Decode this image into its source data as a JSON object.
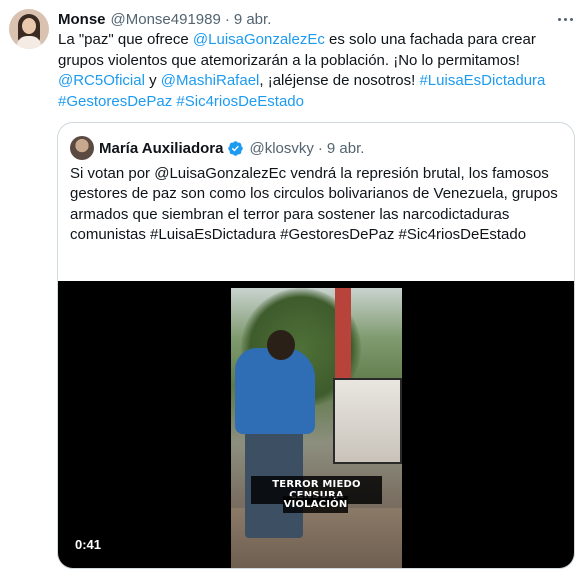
{
  "tweet": {
    "author_name": "Monse",
    "author_handle": "@Monse491989",
    "separator": "·",
    "time": "9 abr.",
    "text_parts": {
      "p1": "La \"paz\" que ofrece ",
      "m1": "@LuisaGonzalezEc",
      "p2": " es solo una fachada para crear grupos violentos que atemorizarán a la población. ¡No lo permitamos! ",
      "m2": "@RC5Oficial",
      "p3": " y ",
      "m3": "@MashiRafael",
      "p4": ", ¡aléjense de nosotros! ",
      "h1": "#LuisaEsDictadura",
      "sp1": " ",
      "h2": "#GestoresDePaz",
      "sp2": " ",
      "h3": "#Sic4riosDeEstado"
    },
    "more_icon": "more-horizontal-icon"
  },
  "quote": {
    "author_name": "María Auxiliadora",
    "verified_icon": "verified-badge-icon",
    "verified_color": "#1d9bf0",
    "author_handle": "@klosvky",
    "separator": "·",
    "time": "9 abr.",
    "text": "Si votan por @LuisaGonzalezEc vendrá la represión brutal, los famosos gestores de paz son como los circulos bolivarianos de Venezuela, grupos armados que siembran el terror para sostener las narcodictaduras comunistas #LuisaEsDictadura #GestoresDePaz #Sic4riosDeEstado",
    "video": {
      "caption_line1": "TERROR MIEDO CENSURA",
      "caption_line2": "VIOLACIÓN",
      "duration": "0:41"
    }
  },
  "colors": {
    "link": "#1d9bf0",
    "text": "#0f1419",
    "secondary": "#536471",
    "border": "#cfd9de"
  }
}
